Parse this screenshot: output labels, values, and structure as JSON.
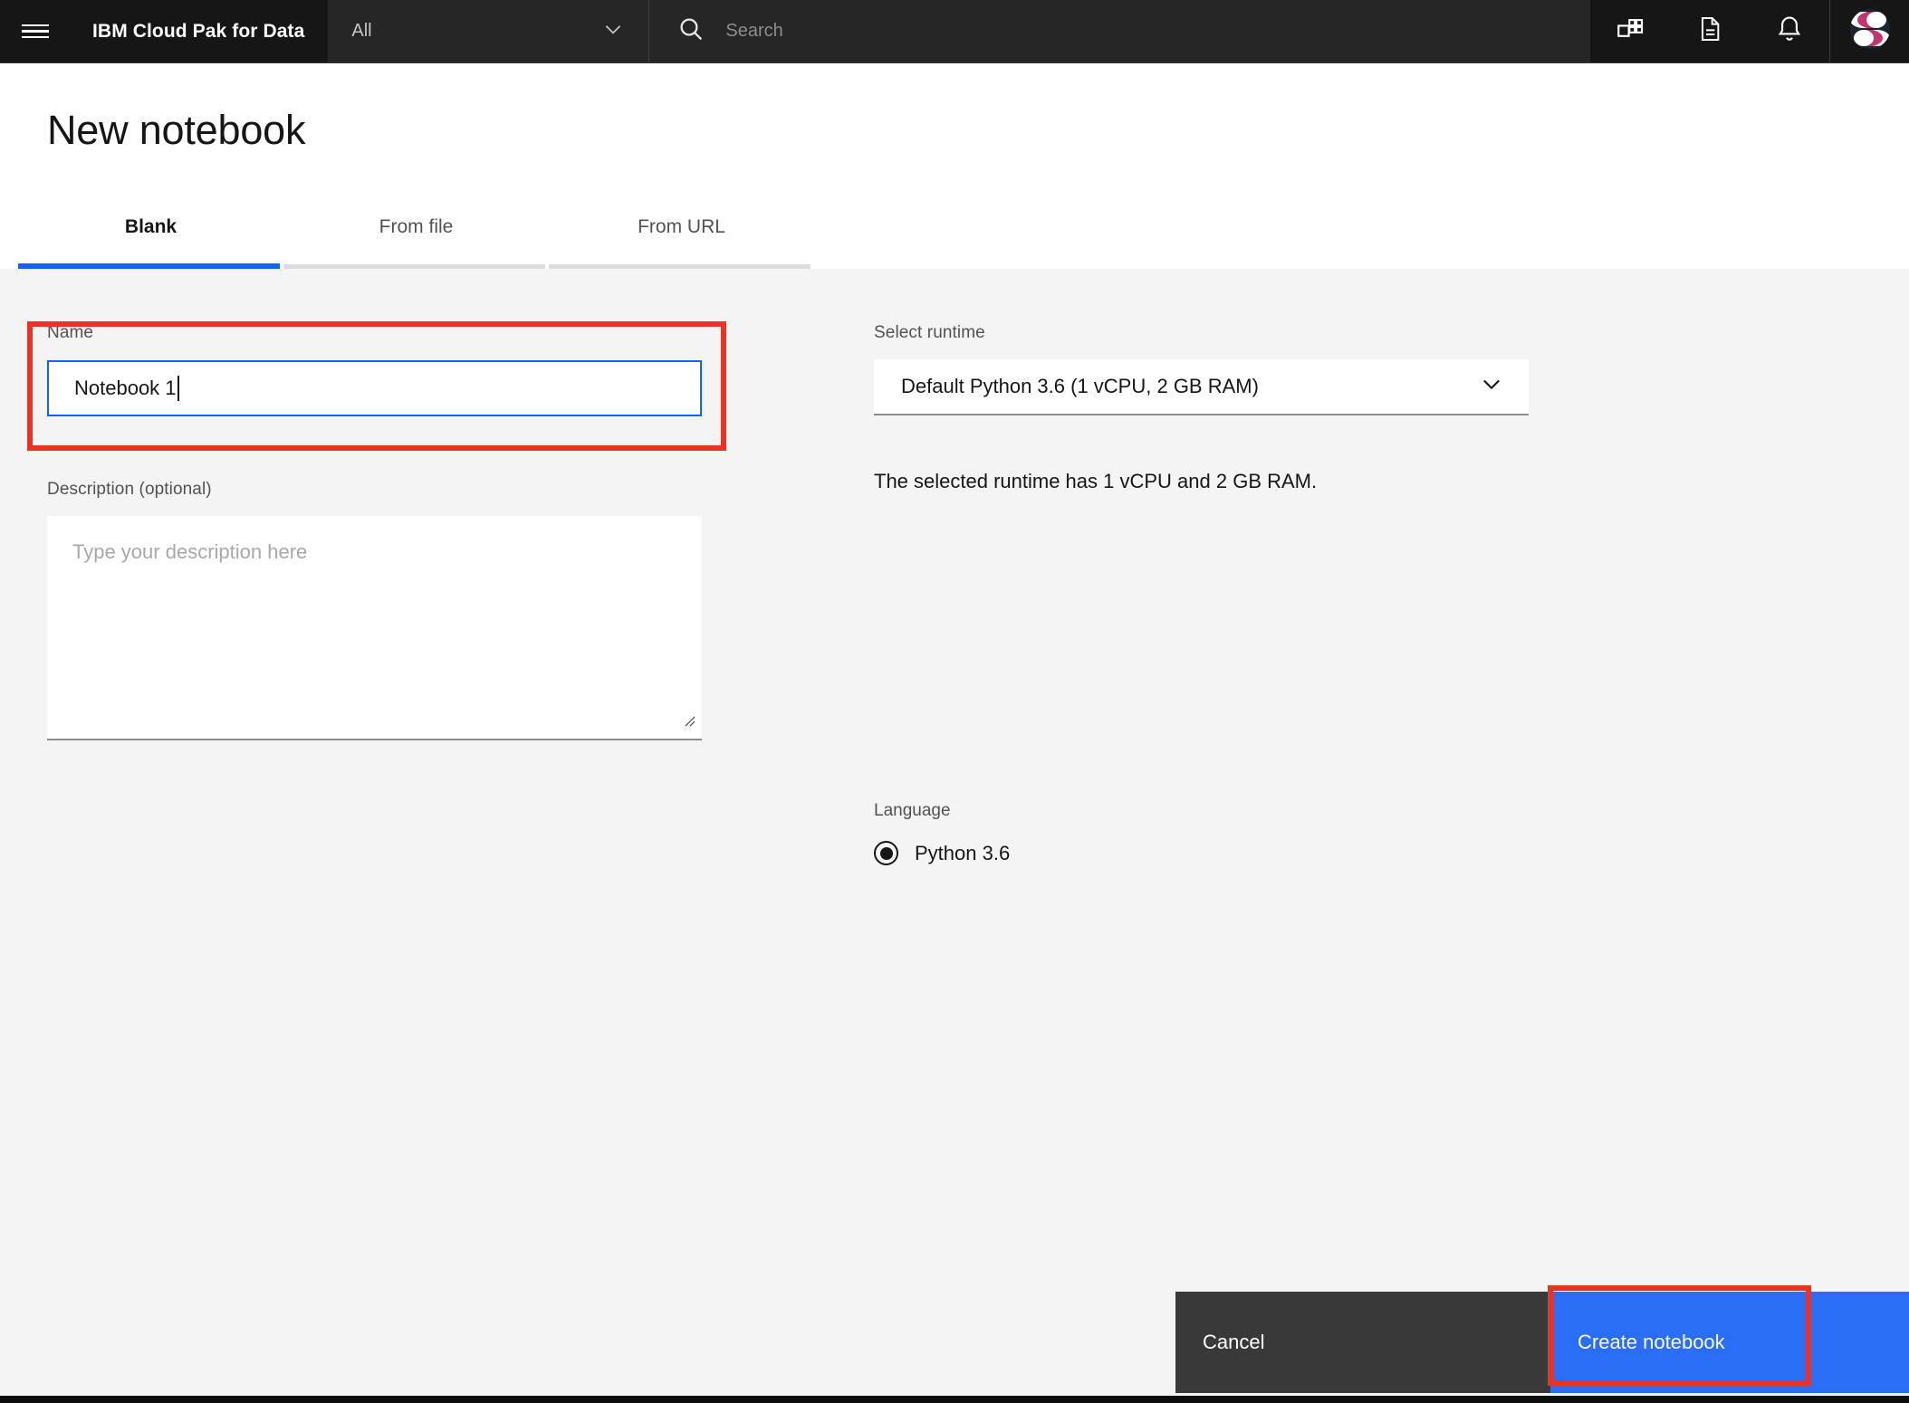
{
  "header": {
    "menu_icon": "hamburger-menu-icon",
    "brand": "IBM Cloud Pak for Data",
    "scope_selected": "All",
    "scope_chevron_icon": "chevron-down-icon",
    "search_icon": "search-icon",
    "search_placeholder": "Search",
    "search_value": "",
    "icons": [
      {
        "name": "app-switcher-icon",
        "label": "Applications"
      },
      {
        "name": "document-icon",
        "label": "Documents"
      },
      {
        "name": "notifications-bell-icon",
        "label": "Notifications"
      }
    ],
    "avatar": {
      "name": "user-avatar",
      "colors": {
        "accent": "#c0356b",
        "background": "#1b2430",
        "highlight": "#ffffff"
      }
    },
    "colors": {
      "background": "#161616",
      "panel": "#262626"
    }
  },
  "page": {
    "title": "New notebook"
  },
  "tabs": [
    {
      "label": "Blank",
      "active": true
    },
    {
      "label": "From file",
      "active": false
    },
    {
      "label": "From URL",
      "active": false
    }
  ],
  "form": {
    "name": {
      "label": "Name",
      "value": "Notebook 1",
      "focused": true
    },
    "description": {
      "label": "Description (optional)",
      "value": "",
      "placeholder": "Type your description here"
    },
    "runtime": {
      "label": "Select runtime",
      "selected": "Default Python 3.6 (1 vCPU, 2 GB RAM)",
      "chevron_icon": "chevron-down-icon",
      "note": "The selected runtime has 1 vCPU and 2 GB RAM."
    },
    "language": {
      "label": "Language",
      "options": [
        {
          "label": "Python 3.6",
          "selected": true
        }
      ]
    }
  },
  "footer": {
    "cancel_label": "Cancel",
    "create_label": "Create notebook"
  },
  "annotations": {
    "highlight_color": "#eb3323",
    "targets": [
      "name-field",
      "create-notebook-button"
    ]
  },
  "colors": {
    "accent_blue": "#0f62fe",
    "button_blue": "#2a6ef5",
    "content_background": "#f4f4f4",
    "dark": "#161616"
  }
}
